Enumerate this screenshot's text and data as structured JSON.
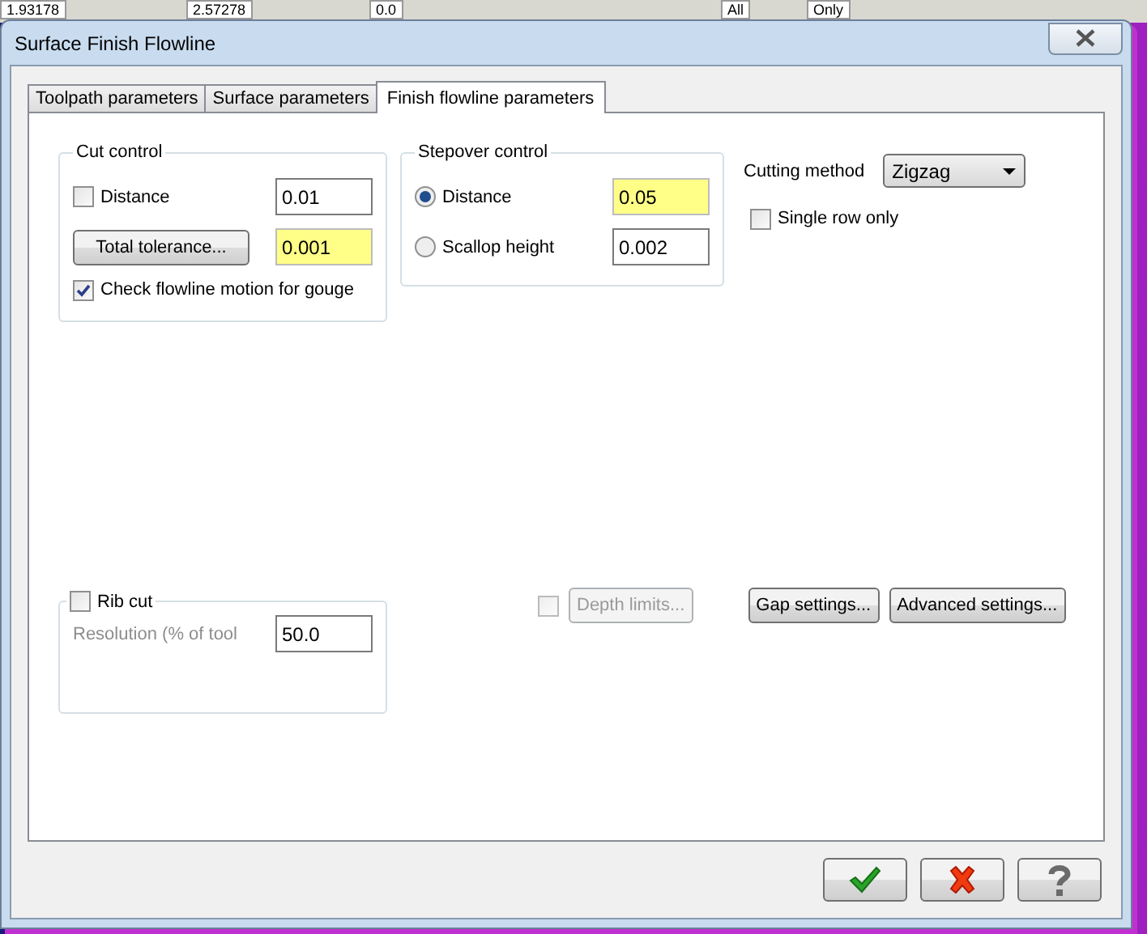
{
  "background_toolbar": [
    "1.93178",
    "2.57278",
    "0.0",
    "All",
    "Only"
  ],
  "window": {
    "title": "Surface Finish Flowline"
  },
  "tabs": [
    {
      "label": "Toolpath parameters",
      "selected": false
    },
    {
      "label": "Surface parameters",
      "selected": false
    },
    {
      "label": "Finish flowline parameters",
      "selected": true
    }
  ],
  "cut_control": {
    "title": "Cut control",
    "distance": {
      "label": "Distance",
      "checked": false,
      "value": "0.01",
      "highlighted": false
    },
    "tolerance": {
      "button": "Total tolerance...",
      "value": "0.001",
      "highlighted": true
    },
    "gouge_check": {
      "label": "Check flowline motion for gouge",
      "checked": true
    }
  },
  "stepover_control": {
    "title": "Stepover control",
    "options": [
      {
        "label": "Distance",
        "selected": true,
        "value": "0.05",
        "highlighted": true
      },
      {
        "label": "Scallop height",
        "selected": false,
        "value": "0.002",
        "highlighted": false
      }
    ]
  },
  "cutting_method": {
    "label": "Cutting method",
    "value": "Zigzag"
  },
  "single_row": {
    "label": "Single row only",
    "checked": false
  },
  "rib_cut": {
    "label": "Rib cut",
    "checked": false,
    "resolution_label": "Resolution (% of tool",
    "resolution_value": "50.0",
    "disabled": true
  },
  "depth_limits": {
    "label": "Depth limits...",
    "checked": false,
    "disabled": true
  },
  "settings_buttons": [
    "Gap settings...",
    "Advanced settings..."
  ]
}
